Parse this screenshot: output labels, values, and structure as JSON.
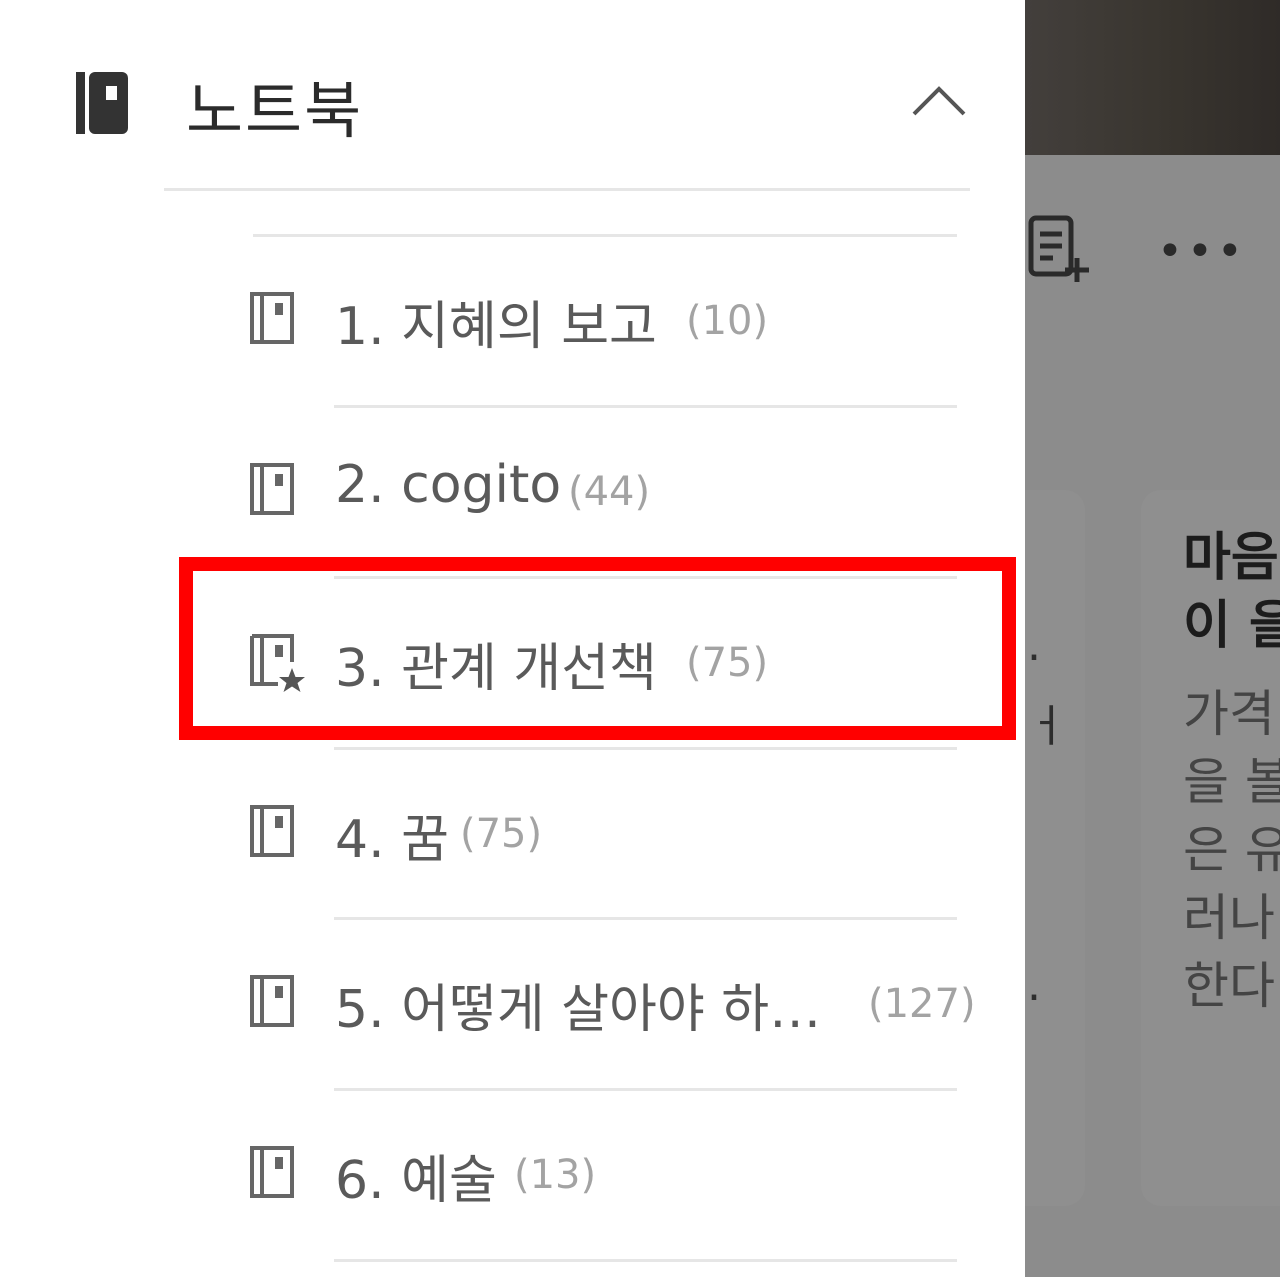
{
  "drawer": {
    "title": "노트북",
    "icon": "notebook-icon",
    "collapse_icon": "chevron-up-icon",
    "notebooks": [
      {
        "label": "1. 지혜의 보고",
        "count": "(10)",
        "icon": "notebook-icon",
        "starred": false
      },
      {
        "label": "2. cogito",
        "count": "(44)",
        "icon": "notebook-icon",
        "starred": false
      },
      {
        "label": "3. 관계 개선책",
        "count": "(75)",
        "icon": "notebook-starred-icon",
        "starred": true
      },
      {
        "label": "4. 꿈",
        "count": "(75)",
        "icon": "notebook-icon",
        "starred": false
      },
      {
        "label": "5. 어떻게 살아야 하…",
        "count": "(127)",
        "icon": "notebook-icon",
        "starred": false
      },
      {
        "label": "6. 예술",
        "count": "(13)",
        "icon": "notebook-icon",
        "starred": false
      }
    ],
    "highlighted_item": "3. 관계 개선책"
  },
  "background": {
    "toolbar_icons": [
      "new-note-icon",
      "more-icon"
    ],
    "more_label": "•••",
    "card_b": {
      "title": "마음\n이 을",
      "body": "가격\n을 볼\n은 유\n러나\n한다"
    },
    "card_a_fragments": [
      ".",
      "ㅓ",
      "."
    ]
  },
  "colors": {
    "highlight": "#ff0000",
    "scrim": "#8c8c8c"
  }
}
